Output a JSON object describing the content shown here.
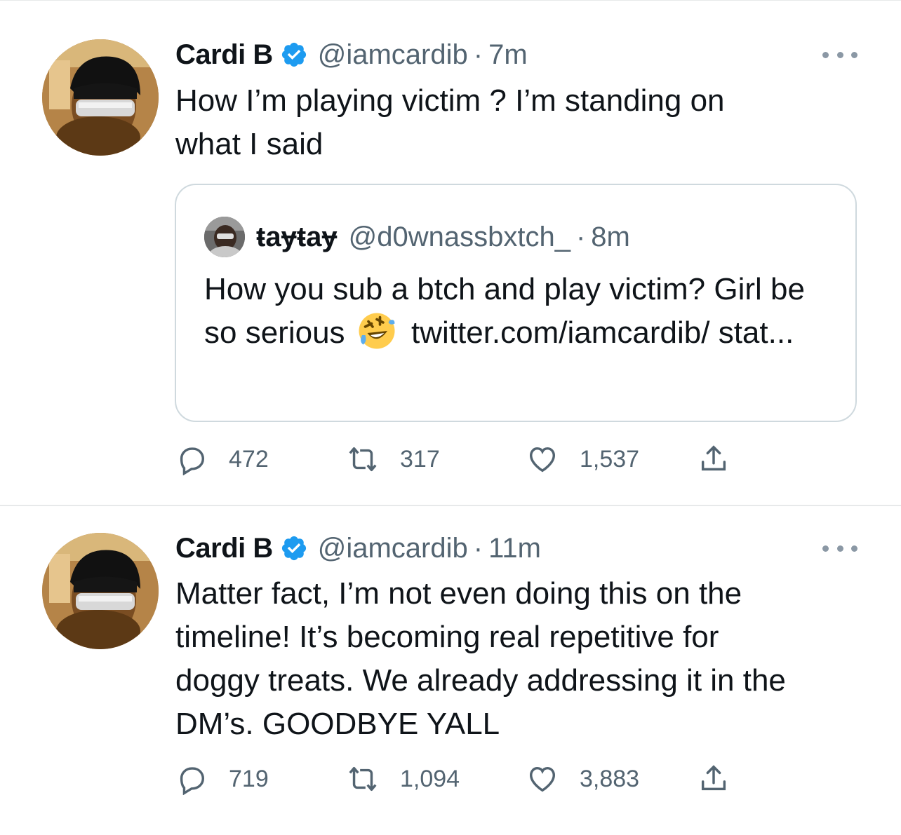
{
  "tweets": [
    {
      "author": {
        "name": "Cardi B",
        "handle": "@iamcardib",
        "verified": true
      },
      "time": "7m",
      "text": "How I’m playing victim ? I’m standing on\nwhat I said",
      "quote": {
        "author": {
          "name": "ŧaɏŧaɏ",
          "handle": "@d0wnassbxtch_"
        },
        "time": "8m",
        "text_before_emoji": "How you sub a btch and play victim? Girl be so serious",
        "emoji": "rolling-on-floor-laughing-emoji",
        "text_after_emoji": "twitter.com/iamcardib/ stat..."
      },
      "stats": {
        "replies": "472",
        "retweets": "317",
        "likes": "1,537"
      }
    },
    {
      "author": {
        "name": "Cardi B",
        "handle": "@iamcardib",
        "verified": true
      },
      "time": "11m",
      "text": "Matter fact, I’m not even doing this on the\ntimeline! It’s becoming real repetitive for\ndoggy treats. We already addressing it in the\nDM’s. GOODBYE YALL",
      "stats": {
        "replies": "719",
        "retweets": "1,094",
        "likes": "3,883"
      }
    }
  ],
  "separator": "·",
  "colors": {
    "verified": "#1d9bf0",
    "secondary_text": "#536471",
    "border": "#cfd9de",
    "icon": "#536471"
  }
}
